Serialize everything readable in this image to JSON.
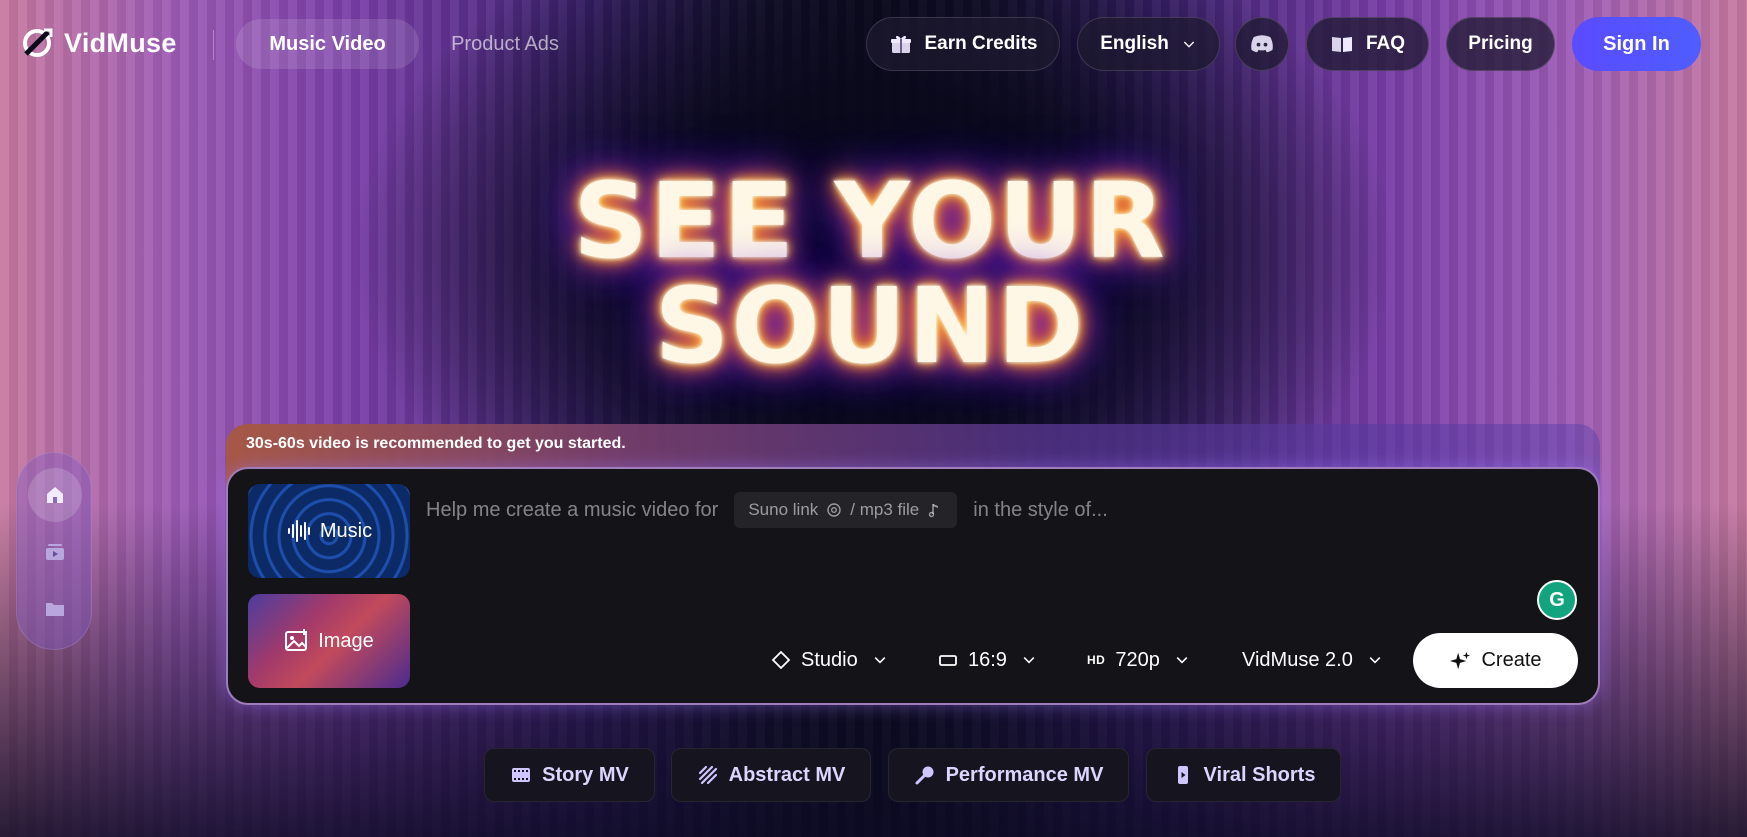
{
  "brand": {
    "name": "VidMuse"
  },
  "nav": {
    "tabs": [
      {
        "label": "Music Video",
        "active": true
      },
      {
        "label": "Product Ads",
        "active": false
      }
    ],
    "earn_credits": "Earn Credits",
    "language": "English",
    "faq": "FAQ",
    "pricing": "Pricing",
    "sign_in": "Sign In"
  },
  "hero": {
    "line1": "SEE YOUR",
    "line2": "SOUND"
  },
  "sidebar": {
    "items": [
      {
        "icon": "home-icon",
        "active": true
      },
      {
        "icon": "video-library-icon",
        "active": false
      },
      {
        "icon": "folder-icon",
        "active": false
      }
    ]
  },
  "composer": {
    "hint": "30s-60s video is recommended to get you started.",
    "modes": [
      {
        "label": "Music",
        "icon": "audio-wave-icon"
      },
      {
        "label": "Image",
        "icon": "image-icon"
      }
    ],
    "prompt_prefix": "Help me create a music video for",
    "chip_link": "Suno link",
    "chip_file": "/ mp3 file",
    "prompt_suffix": "in the style of...",
    "options": {
      "style": "Studio",
      "aspect": "16:9",
      "quality_badge": "HD",
      "resolution": "720p",
      "model": "VidMuse 2.0"
    },
    "create": "Create"
  },
  "categories": [
    {
      "label": "Story MV",
      "icon": "film-icon"
    },
    {
      "label": "Abstract MV",
      "icon": "abstract-pattern-icon"
    },
    {
      "label": "Performance MV",
      "icon": "microphone-icon"
    },
    {
      "label": "Viral Shorts",
      "icon": "phone-icon"
    }
  ],
  "colors": {
    "accent": "#5a4bff",
    "background": "#0b0a1c",
    "composer_border": "#dcaaff"
  }
}
